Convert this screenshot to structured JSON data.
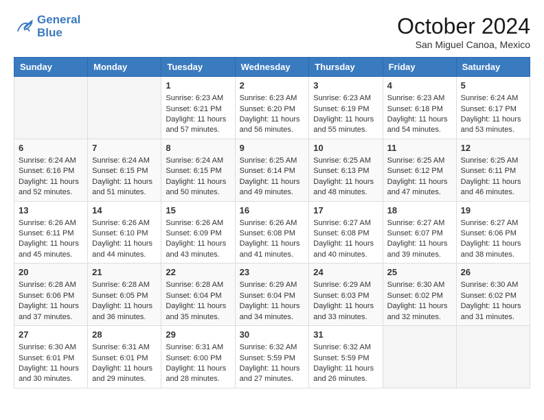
{
  "header": {
    "logo_line1": "General",
    "logo_line2": "Blue",
    "month": "October 2024",
    "location": "San Miguel Canoa, Mexico"
  },
  "weekdays": [
    "Sunday",
    "Monday",
    "Tuesday",
    "Wednesday",
    "Thursday",
    "Friday",
    "Saturday"
  ],
  "weeks": [
    [
      {
        "day": "",
        "sunrise": "",
        "sunset": "",
        "daylight": ""
      },
      {
        "day": "",
        "sunrise": "",
        "sunset": "",
        "daylight": ""
      },
      {
        "day": "1",
        "sunrise": "Sunrise: 6:23 AM",
        "sunset": "Sunset: 6:21 PM",
        "daylight": "Daylight: 11 hours and 57 minutes."
      },
      {
        "day": "2",
        "sunrise": "Sunrise: 6:23 AM",
        "sunset": "Sunset: 6:20 PM",
        "daylight": "Daylight: 11 hours and 56 minutes."
      },
      {
        "day": "3",
        "sunrise": "Sunrise: 6:23 AM",
        "sunset": "Sunset: 6:19 PM",
        "daylight": "Daylight: 11 hours and 55 minutes."
      },
      {
        "day": "4",
        "sunrise": "Sunrise: 6:23 AM",
        "sunset": "Sunset: 6:18 PM",
        "daylight": "Daylight: 11 hours and 54 minutes."
      },
      {
        "day": "5",
        "sunrise": "Sunrise: 6:24 AM",
        "sunset": "Sunset: 6:17 PM",
        "daylight": "Daylight: 11 hours and 53 minutes."
      }
    ],
    [
      {
        "day": "6",
        "sunrise": "Sunrise: 6:24 AM",
        "sunset": "Sunset: 6:16 PM",
        "daylight": "Daylight: 11 hours and 52 minutes."
      },
      {
        "day": "7",
        "sunrise": "Sunrise: 6:24 AM",
        "sunset": "Sunset: 6:15 PM",
        "daylight": "Daylight: 11 hours and 51 minutes."
      },
      {
        "day": "8",
        "sunrise": "Sunrise: 6:24 AM",
        "sunset": "Sunset: 6:15 PM",
        "daylight": "Daylight: 11 hours and 50 minutes."
      },
      {
        "day": "9",
        "sunrise": "Sunrise: 6:25 AM",
        "sunset": "Sunset: 6:14 PM",
        "daylight": "Daylight: 11 hours and 49 minutes."
      },
      {
        "day": "10",
        "sunrise": "Sunrise: 6:25 AM",
        "sunset": "Sunset: 6:13 PM",
        "daylight": "Daylight: 11 hours and 48 minutes."
      },
      {
        "day": "11",
        "sunrise": "Sunrise: 6:25 AM",
        "sunset": "Sunset: 6:12 PM",
        "daylight": "Daylight: 11 hours and 47 minutes."
      },
      {
        "day": "12",
        "sunrise": "Sunrise: 6:25 AM",
        "sunset": "Sunset: 6:11 PM",
        "daylight": "Daylight: 11 hours and 46 minutes."
      }
    ],
    [
      {
        "day": "13",
        "sunrise": "Sunrise: 6:26 AM",
        "sunset": "Sunset: 6:11 PM",
        "daylight": "Daylight: 11 hours and 45 minutes."
      },
      {
        "day": "14",
        "sunrise": "Sunrise: 6:26 AM",
        "sunset": "Sunset: 6:10 PM",
        "daylight": "Daylight: 11 hours and 44 minutes."
      },
      {
        "day": "15",
        "sunrise": "Sunrise: 6:26 AM",
        "sunset": "Sunset: 6:09 PM",
        "daylight": "Daylight: 11 hours and 43 minutes."
      },
      {
        "day": "16",
        "sunrise": "Sunrise: 6:26 AM",
        "sunset": "Sunset: 6:08 PM",
        "daylight": "Daylight: 11 hours and 41 minutes."
      },
      {
        "day": "17",
        "sunrise": "Sunrise: 6:27 AM",
        "sunset": "Sunset: 6:08 PM",
        "daylight": "Daylight: 11 hours and 40 minutes."
      },
      {
        "day": "18",
        "sunrise": "Sunrise: 6:27 AM",
        "sunset": "Sunset: 6:07 PM",
        "daylight": "Daylight: 11 hours and 39 minutes."
      },
      {
        "day": "19",
        "sunrise": "Sunrise: 6:27 AM",
        "sunset": "Sunset: 6:06 PM",
        "daylight": "Daylight: 11 hours and 38 minutes."
      }
    ],
    [
      {
        "day": "20",
        "sunrise": "Sunrise: 6:28 AM",
        "sunset": "Sunset: 6:06 PM",
        "daylight": "Daylight: 11 hours and 37 minutes."
      },
      {
        "day": "21",
        "sunrise": "Sunrise: 6:28 AM",
        "sunset": "Sunset: 6:05 PM",
        "daylight": "Daylight: 11 hours and 36 minutes."
      },
      {
        "day": "22",
        "sunrise": "Sunrise: 6:28 AM",
        "sunset": "Sunset: 6:04 PM",
        "daylight": "Daylight: 11 hours and 35 minutes."
      },
      {
        "day": "23",
        "sunrise": "Sunrise: 6:29 AM",
        "sunset": "Sunset: 6:04 PM",
        "daylight": "Daylight: 11 hours and 34 minutes."
      },
      {
        "day": "24",
        "sunrise": "Sunrise: 6:29 AM",
        "sunset": "Sunset: 6:03 PM",
        "daylight": "Daylight: 11 hours and 33 minutes."
      },
      {
        "day": "25",
        "sunrise": "Sunrise: 6:30 AM",
        "sunset": "Sunset: 6:02 PM",
        "daylight": "Daylight: 11 hours and 32 minutes."
      },
      {
        "day": "26",
        "sunrise": "Sunrise: 6:30 AM",
        "sunset": "Sunset: 6:02 PM",
        "daylight": "Daylight: 11 hours and 31 minutes."
      }
    ],
    [
      {
        "day": "27",
        "sunrise": "Sunrise: 6:30 AM",
        "sunset": "Sunset: 6:01 PM",
        "daylight": "Daylight: 11 hours and 30 minutes."
      },
      {
        "day": "28",
        "sunrise": "Sunrise: 6:31 AM",
        "sunset": "Sunset: 6:01 PM",
        "daylight": "Daylight: 11 hours and 29 minutes."
      },
      {
        "day": "29",
        "sunrise": "Sunrise: 6:31 AM",
        "sunset": "Sunset: 6:00 PM",
        "daylight": "Daylight: 11 hours and 28 minutes."
      },
      {
        "day": "30",
        "sunrise": "Sunrise: 6:32 AM",
        "sunset": "Sunset: 5:59 PM",
        "daylight": "Daylight: 11 hours and 27 minutes."
      },
      {
        "day": "31",
        "sunrise": "Sunrise: 6:32 AM",
        "sunset": "Sunset: 5:59 PM",
        "daylight": "Daylight: 11 hours and 26 minutes."
      },
      {
        "day": "",
        "sunrise": "",
        "sunset": "",
        "daylight": ""
      },
      {
        "day": "",
        "sunrise": "",
        "sunset": "",
        "daylight": ""
      }
    ]
  ]
}
